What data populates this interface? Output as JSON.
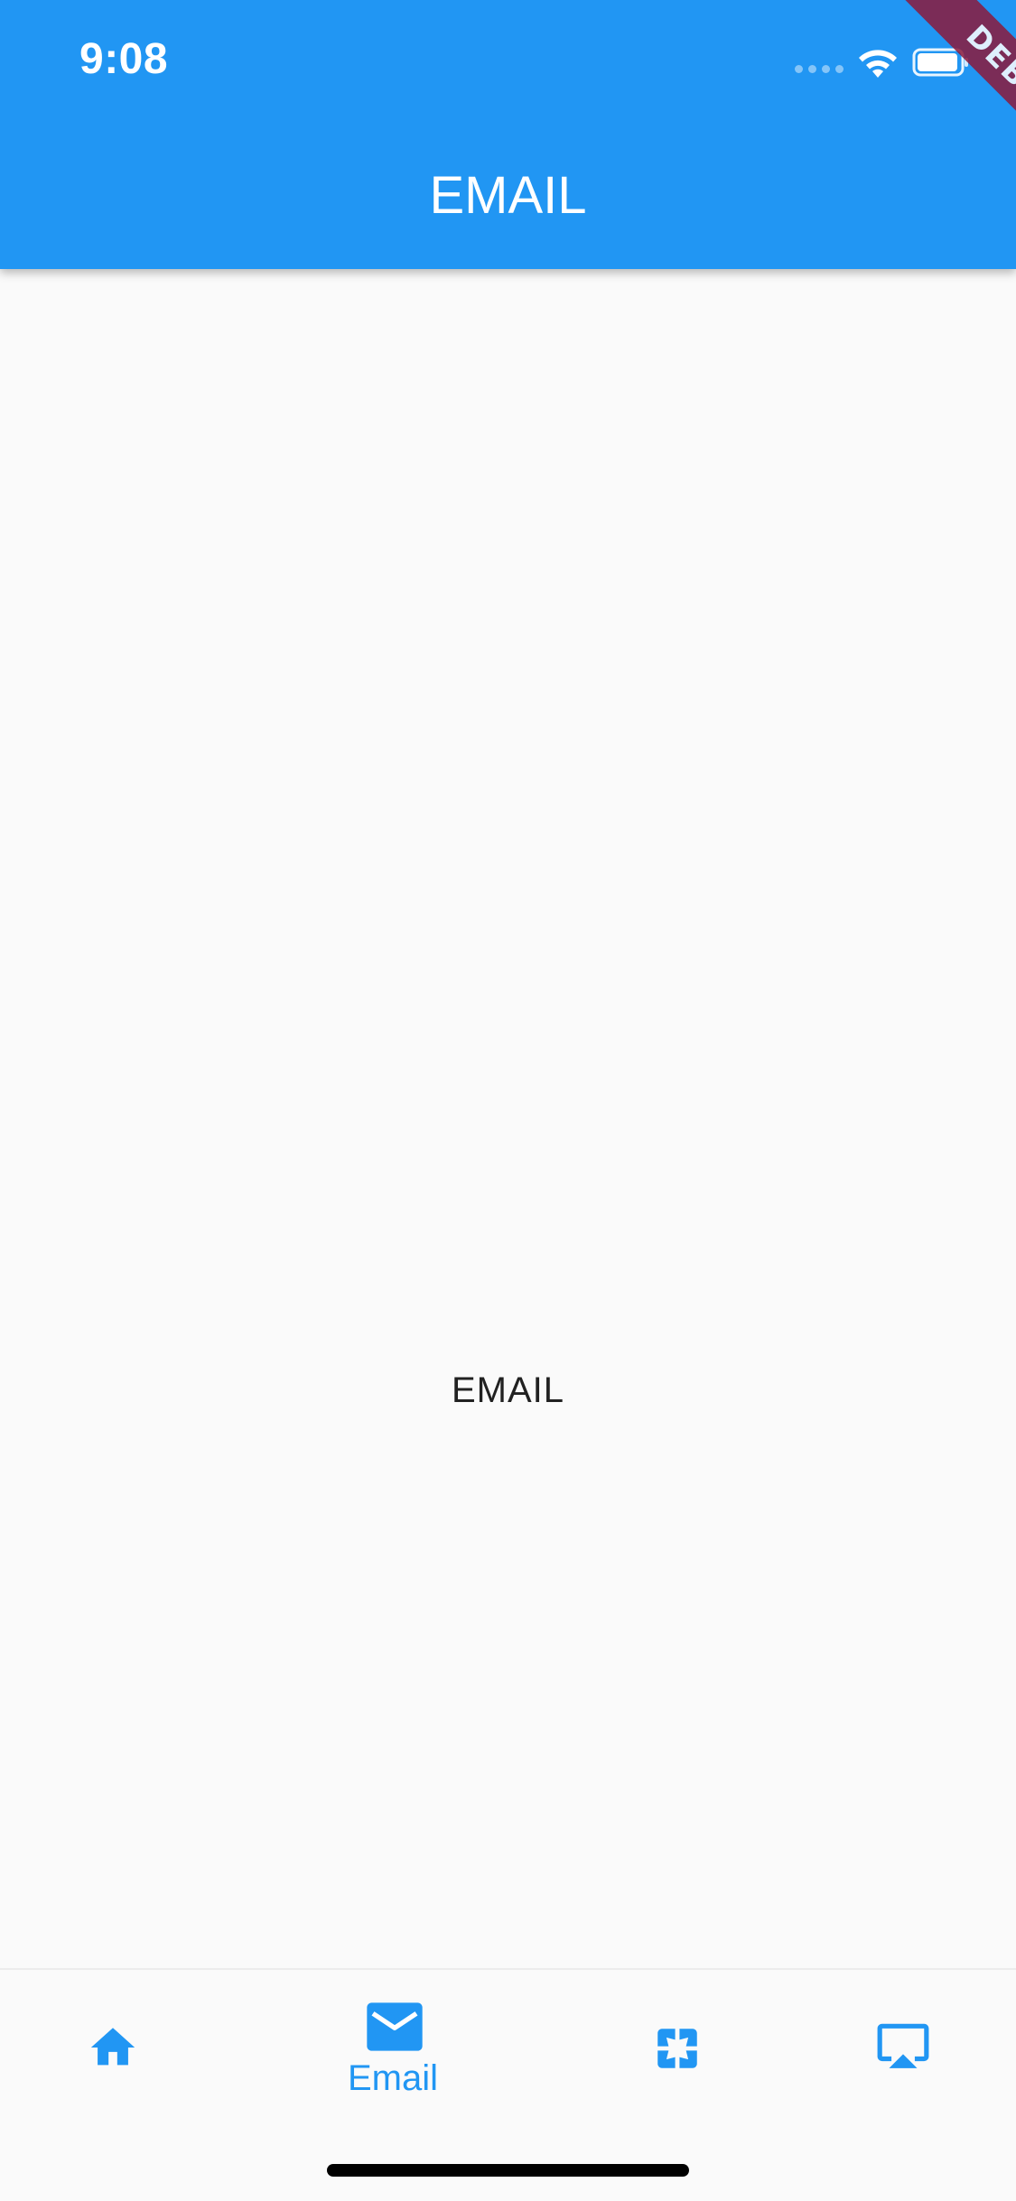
{
  "status_bar": {
    "time": "9:08",
    "icons": [
      "signal-dots-icon",
      "wifi-icon",
      "battery-icon"
    ]
  },
  "debug_banner": {
    "label": "DEBUG"
  },
  "app_bar": {
    "title": "EMAIL"
  },
  "content": {
    "label": "EMAIL"
  },
  "bottom_nav": {
    "items": [
      {
        "icon": "home-icon",
        "label": "",
        "selected": false
      },
      {
        "icon": "email-icon",
        "label": "Email",
        "selected": true
      },
      {
        "icon": "pages-icon",
        "label": "",
        "selected": false
      },
      {
        "icon": "airplay-icon",
        "label": "",
        "selected": false
      }
    ]
  },
  "colors": {
    "primary": "#2196f3",
    "background": "#fafafa",
    "debug_banner": "#8b1a3c",
    "text": "#212121"
  }
}
